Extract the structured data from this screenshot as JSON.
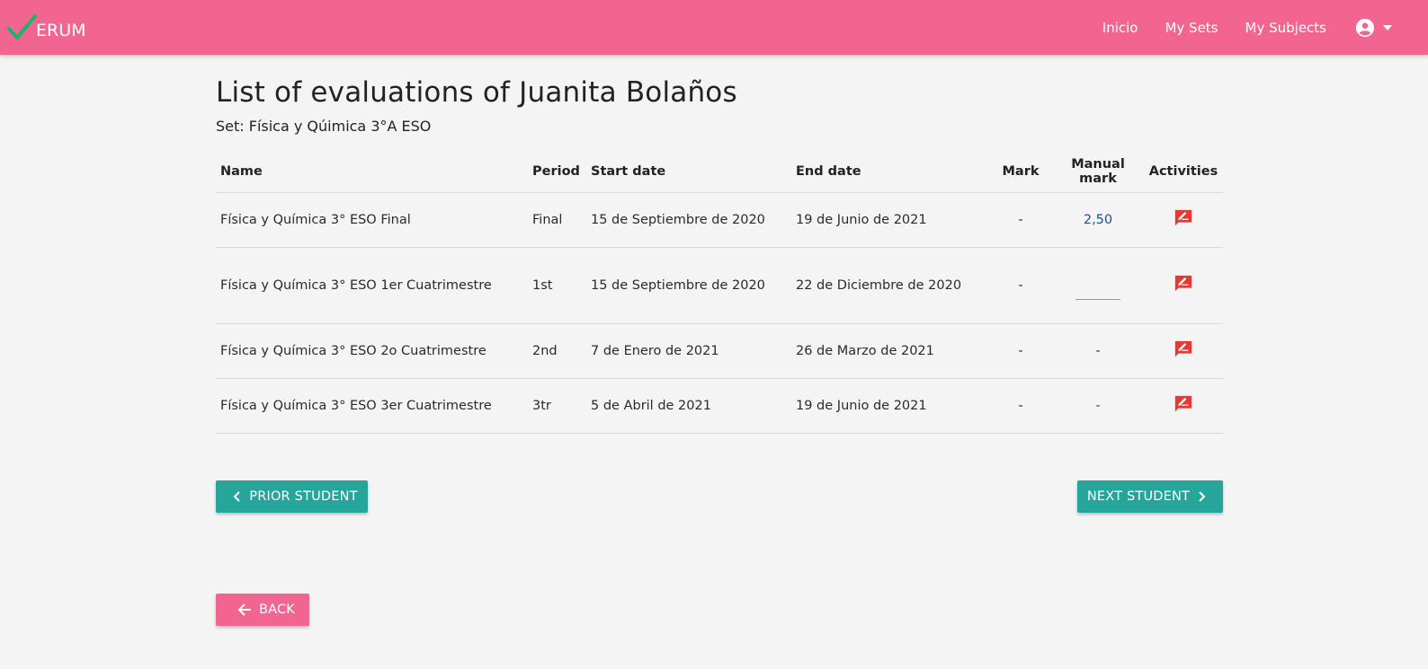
{
  "app": {
    "logo_text": "ERUM",
    "brand_color": "#f26591",
    "accent_color": "#26a69a"
  },
  "nav": {
    "items": [
      {
        "label": "Inicio"
      },
      {
        "label": "My Sets"
      },
      {
        "label": "My Subjects"
      }
    ],
    "account_icon": "account-circle-icon"
  },
  "page": {
    "title": "List of evaluations of Juanita Bolaños",
    "subtitle": "Set: Física y Qúimica 3°A ESO"
  },
  "table": {
    "headers": {
      "name": "Name",
      "period": "Period",
      "start": "Start date",
      "end": "End date",
      "mark": "Mark",
      "manual": "Manual mark",
      "activities": "Activities"
    },
    "rows": [
      {
        "name": "Física y Química 3° ESO Final",
        "period": "Final",
        "start": "15 de Septiembre de 2020",
        "end": "19 de Junio de 2021",
        "mark": "-",
        "manual": "2,50",
        "manual_type": "link"
      },
      {
        "name": "Física y Química 3° ESO 1er Cuatrimestre",
        "period": "1st",
        "start": "15 de Septiembre de 2020",
        "end": "22 de Diciembre de 2020",
        "mark": "-",
        "manual": "",
        "manual_type": "input"
      },
      {
        "name": "Física y Química 3° ESO 2o Cuatrimestre",
        "period": "2nd",
        "start": "7 de Enero de 2021",
        "end": "26 de Marzo de 2021",
        "mark": "-",
        "manual": "-",
        "manual_type": "text"
      },
      {
        "name": "Física y Química 3° ESO 3er Cuatrimestre",
        "period": "3tr",
        "start": "5 de Abril de 2021",
        "end": "19 de Junio de 2021",
        "mark": "-",
        "manual": "-",
        "manual_type": "link"
      }
    ],
    "activity_icon": "rate-review-icon",
    "activity_icon_color": "#e53935"
  },
  "buttons": {
    "prior": "PRIOR STUDENT",
    "next": "NEXT STUDENT",
    "back": "BACK"
  }
}
